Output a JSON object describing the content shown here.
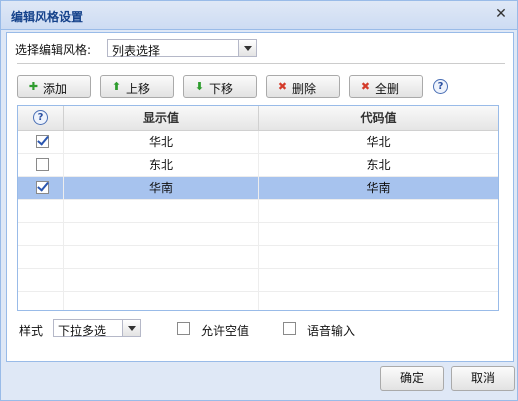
{
  "window": {
    "title": "编辑风格设置"
  },
  "style_select": {
    "label": "选择编辑风格:",
    "value": "列表选择"
  },
  "toolbar": {
    "add": {
      "label": "添加",
      "icon": "plus-icon",
      "color": "#2e9c2e"
    },
    "up": {
      "label": "上移",
      "icon": "arrow-up-icon",
      "color": "#2e9c2e"
    },
    "down": {
      "label": "下移",
      "icon": "arrow-down-icon",
      "color": "#2e9c2e"
    },
    "delete": {
      "label": "删除",
      "icon": "delete-x-icon",
      "color": "#d43b2a"
    },
    "delete_all": {
      "label": "全删",
      "icon": "delete-all-icon",
      "color": "#d43b2a"
    },
    "help": "?"
  },
  "grid": {
    "help": "?",
    "columns": {
      "display": "显示值",
      "code": "代码值"
    },
    "rows": [
      {
        "display": "华北",
        "code": "华北",
        "checked": true,
        "selected": false
      },
      {
        "display": "东北",
        "code": "东北",
        "checked": false,
        "selected": false
      },
      {
        "display": "华南",
        "code": "华南",
        "checked": true,
        "selected": true
      }
    ]
  },
  "options": {
    "style_label": "样式",
    "style_value": "下拉多选",
    "allow_empty": "允许空值",
    "voice_input": "语音输入"
  },
  "footer": {
    "ok": "确定",
    "cancel": "取消"
  }
}
